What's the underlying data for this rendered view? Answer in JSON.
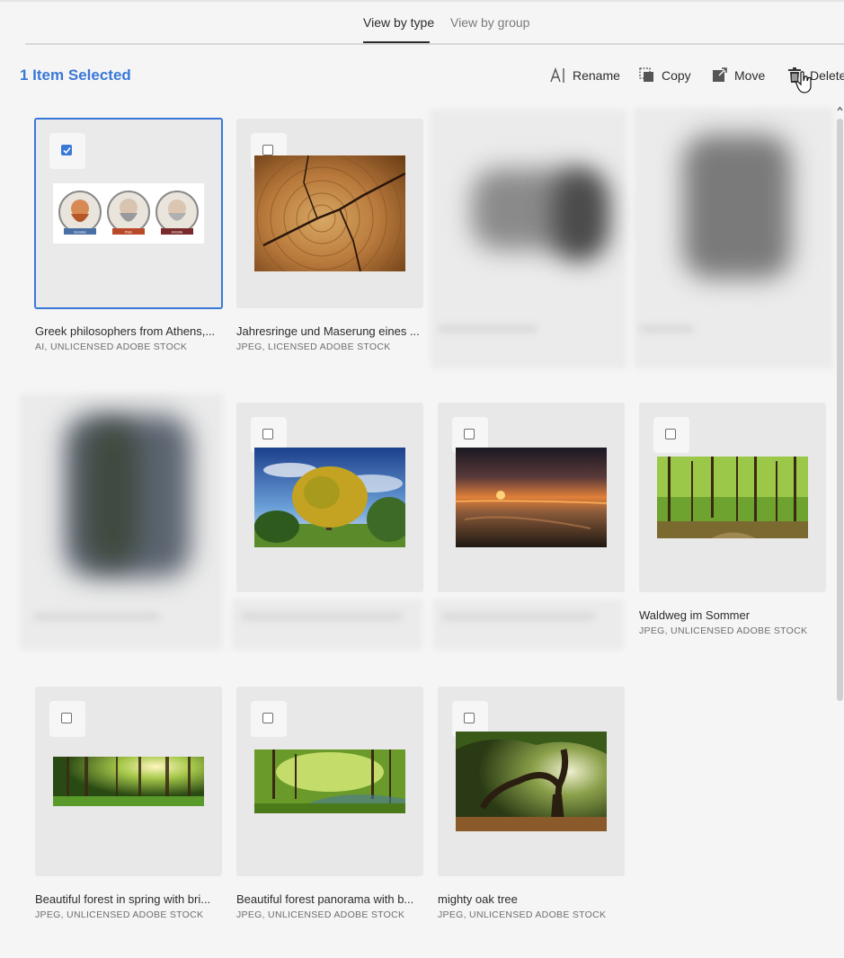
{
  "tabs": [
    {
      "label": "View by type",
      "active": true
    },
    {
      "label": "View by group",
      "active": false
    }
  ],
  "selection": {
    "count_label": "1 Item Selected"
  },
  "actions": {
    "rename": "Rename",
    "copy": "Copy",
    "move": "Move",
    "delete": "Delete"
  },
  "accent_color": "#3a78d8",
  "assets": [
    {
      "title": "Greek philosophers from Athens,...",
      "meta": "AI, UNLICENSED ADOBE STOCK",
      "checked": true,
      "icons": [
        "philosopher-illustration"
      ],
      "badges": [
        "Socrates",
        "Plato",
        "Aristotle"
      ]
    },
    {
      "title": "Jahresringe und Maserung eines ...",
      "meta": "JPEG, LICENSED ADOBE STOCK",
      "checked": false
    },
    {
      "title": "Waldweg im Sommer",
      "meta": "JPEG, UNLICENSED ADOBE STOCK",
      "checked": false
    },
    {
      "title": "Beautiful forest in spring with bri...",
      "meta": "JPEG, UNLICENSED ADOBE STOCK",
      "checked": false
    },
    {
      "title": "Beautiful forest panorama with b...",
      "meta": "JPEG, UNLICENSED ADOBE STOCK",
      "checked": false
    },
    {
      "title": "mighty oak tree",
      "meta": "JPEG, UNLICENSED ADOBE STOCK",
      "checked": false
    }
  ]
}
